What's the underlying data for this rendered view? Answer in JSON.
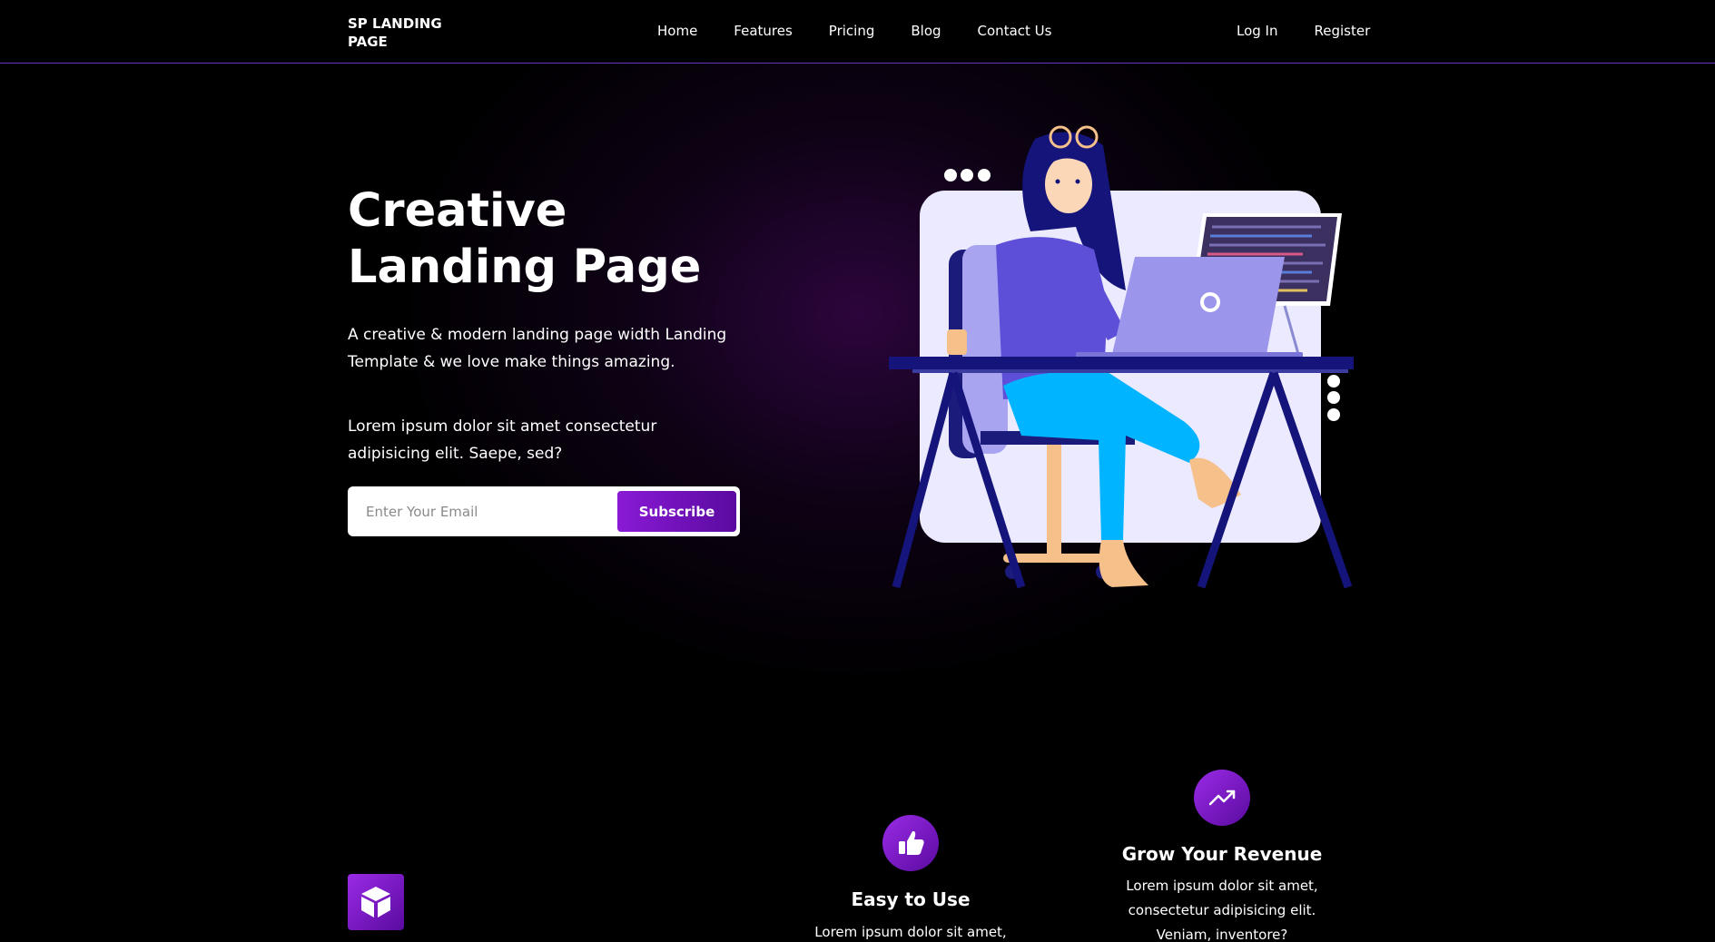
{
  "brand": {
    "name": "SP LANDING PAGE"
  },
  "nav": {
    "items": [
      {
        "label": "Home"
      },
      {
        "label": "Features"
      },
      {
        "label": "Pricing"
      },
      {
        "label": "Blog"
      },
      {
        "label": "Contact Us"
      }
    ],
    "login_label": "Log In",
    "register_label": "Register"
  },
  "hero": {
    "title": "Creative Landing Page",
    "subtitle": "A creative & modern landing page width Landing Template & we love make things amazing.",
    "lorem": "Lorem ipsum dolor sit amet consectetur adipisicing elit. Saepe, sed?",
    "email_placeholder": "Enter Your Email",
    "subscribe_label": "Subscribe"
  },
  "features": [
    {
      "icon": "cube-icon",
      "title": "",
      "text": ""
    },
    {
      "icon": "thumbs-up-icon",
      "title": "Easy to Use",
      "text": "Lorem ipsum dolor sit amet,"
    },
    {
      "icon": "trending-up-icon",
      "title": "Grow Your Revenue",
      "text": "Lorem ipsum dolor sit amet, consectetur adipisicing elit. Veniam, inventore?"
    }
  ],
  "colors": {
    "accent": "#8a1ad6",
    "accent_dark": "#5a0aa0",
    "background": "#000000",
    "navbar_border": "#6a2fc0"
  }
}
